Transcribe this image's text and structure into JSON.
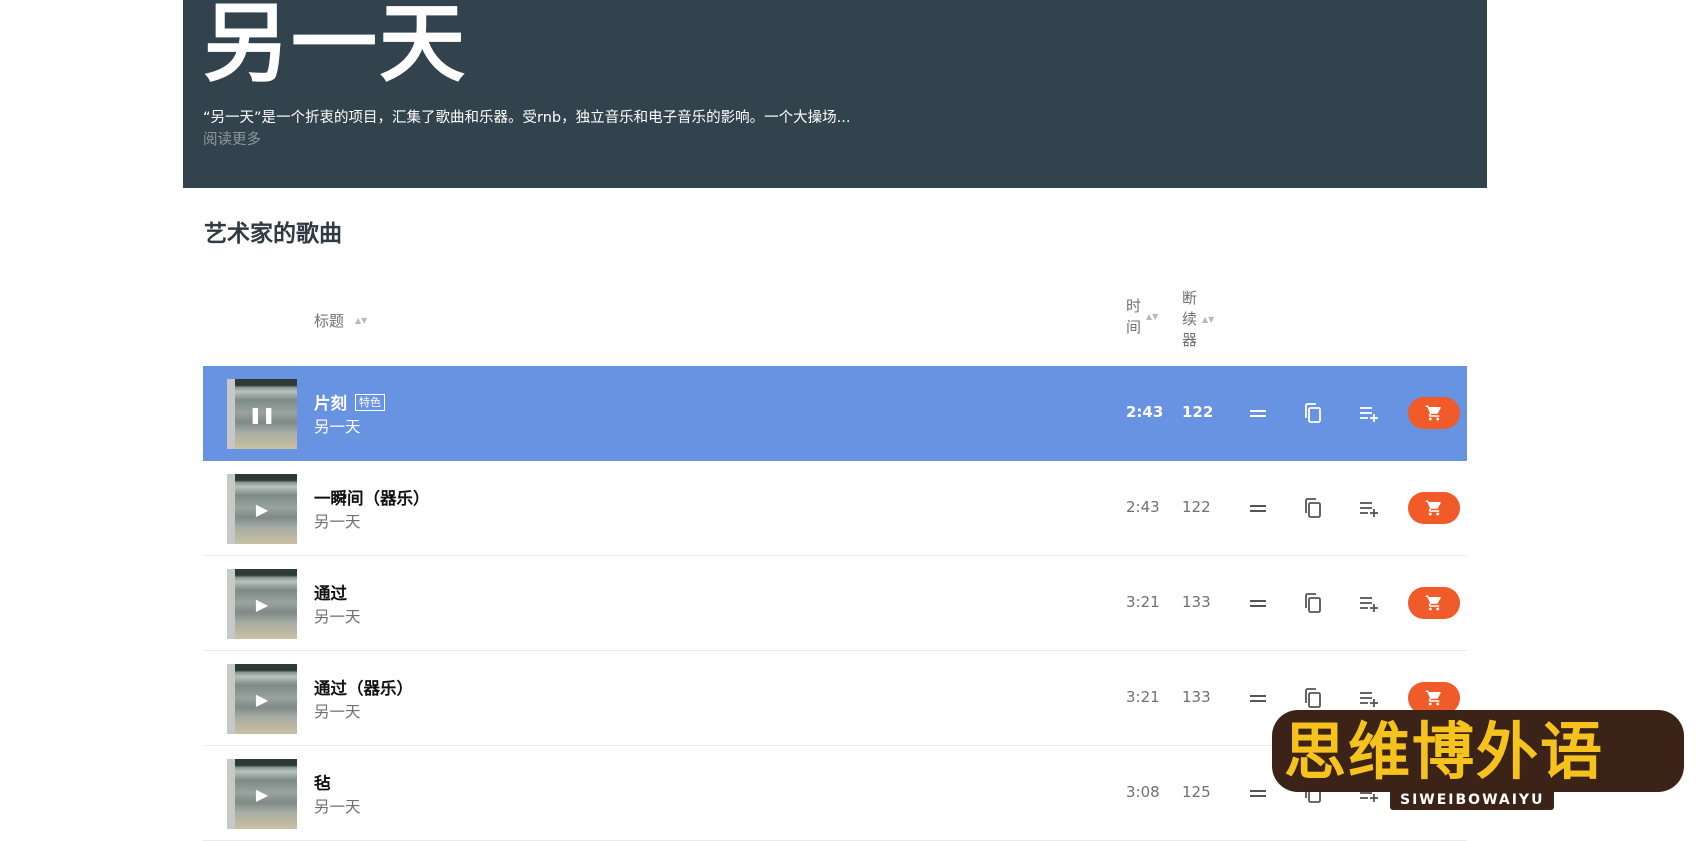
{
  "hero": {
    "title": "另一天",
    "description": "“另一天”是一个折衷的项目，汇集了歌曲和乐器。受rnb，独立音乐和电子音乐的影响。一个大操场...",
    "read_more": "阅读更多"
  },
  "section_title": "艺术家的歌曲",
  "table": {
    "columns": {
      "title": "标题",
      "time": [
        "时",
        "间"
      ],
      "bpm": [
        "断",
        "续",
        "器"
      ]
    },
    "rows": [
      {
        "name": "片刻",
        "badge": "特色",
        "artist": "另一天",
        "duration": "2:43",
        "bpm": "122",
        "state": "playing"
      },
      {
        "name": "一瞬间（器乐）",
        "badge": "",
        "artist": "另一天",
        "duration": "2:43",
        "bpm": "122",
        "state": "paused"
      },
      {
        "name": "通过",
        "badge": "",
        "artist": "另一天",
        "duration": "3:21",
        "bpm": "133",
        "state": "paused"
      },
      {
        "name": "通过（器乐）",
        "badge": "",
        "artist": "另一天",
        "duration": "3:21",
        "bpm": "133",
        "state": "paused"
      },
      {
        "name": "毡",
        "badge": "",
        "artist": "另一天",
        "duration": "3:08",
        "bpm": "125",
        "state": "paused"
      }
    ]
  },
  "colors": {
    "hero_bg": "#33434d",
    "active_row": "#6892e2",
    "cart_button": "#f15a29"
  },
  "icons": [
    "pause-icon",
    "play-icon",
    "menu-icon",
    "copy-icon",
    "add-to-queue-icon",
    "cart-icon",
    "sort-icon"
  ],
  "watermark": {
    "text": "思维博外语",
    "sub": "SIWEIBOWAIYU"
  }
}
